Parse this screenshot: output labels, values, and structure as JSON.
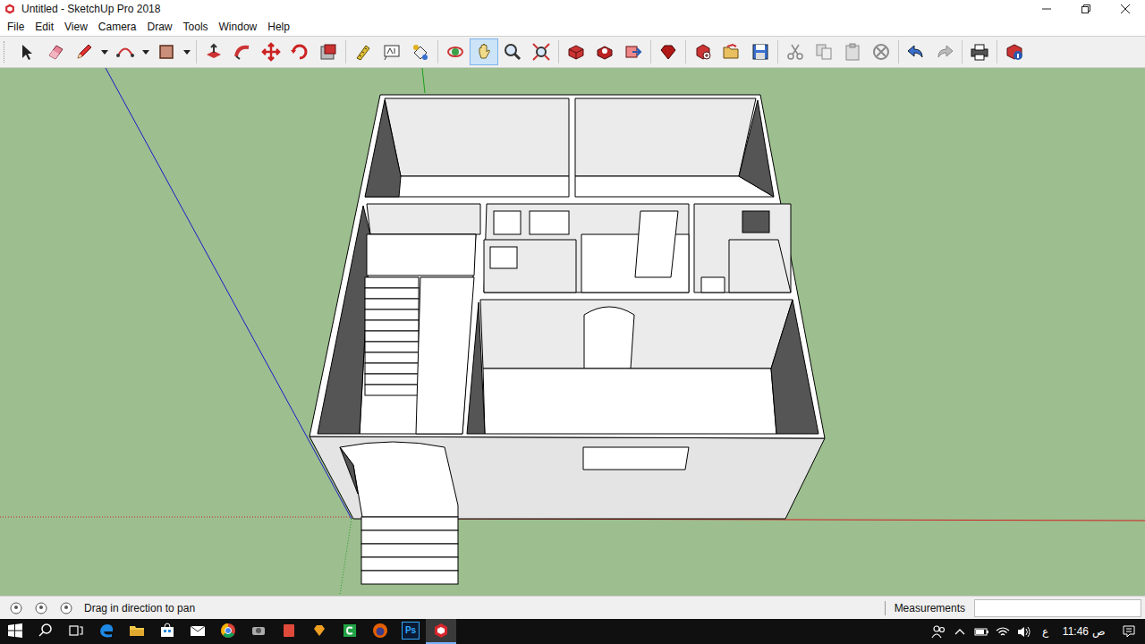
{
  "window": {
    "title": "Untitled - SketchUp Pro 2018"
  },
  "menu": [
    "File",
    "Edit",
    "View",
    "Camera",
    "Draw",
    "Tools",
    "Window",
    "Help"
  ],
  "toolbar": {
    "groups": [
      [
        {
          "kind": "select",
          "selected": false,
          "has_menu": false
        },
        {
          "kind": "eraser",
          "selected": false,
          "has_menu": false
        },
        {
          "kind": "pencil",
          "selected": false,
          "has_menu": true
        },
        {
          "kind": "arc",
          "selected": false,
          "has_menu": true
        },
        {
          "kind": "rectangle",
          "selected": false,
          "has_menu": true
        }
      ],
      [
        {
          "kind": "pushpull",
          "selected": false,
          "has_menu": false
        },
        {
          "kind": "followme",
          "selected": false,
          "has_menu": false
        },
        {
          "kind": "move",
          "selected": false,
          "has_menu": false
        },
        {
          "kind": "rotate",
          "selected": false,
          "has_menu": false
        },
        {
          "kind": "offset",
          "selected": false,
          "has_menu": false
        }
      ],
      [
        {
          "kind": "tape",
          "selected": false,
          "has_menu": false
        },
        {
          "kind": "text",
          "selected": false,
          "has_menu": false
        },
        {
          "kind": "paint",
          "selected": false,
          "has_menu": false
        }
      ],
      [
        {
          "kind": "orbit",
          "selected": false,
          "has_menu": false
        },
        {
          "kind": "pan",
          "selected": true,
          "has_menu": false
        },
        {
          "kind": "zoom",
          "selected": false,
          "has_menu": false
        },
        {
          "kind": "zoomextents",
          "selected": false,
          "has_menu": false
        }
      ],
      [
        {
          "kind": "warehouse",
          "selected": false,
          "has_menu": false
        },
        {
          "kind": "extension",
          "selected": false,
          "has_menu": false
        },
        {
          "kind": "send",
          "selected": false,
          "has_menu": false
        }
      ],
      [
        {
          "kind": "ruby",
          "selected": false,
          "has_menu": false
        }
      ],
      [
        {
          "kind": "new",
          "selected": false,
          "has_menu": false
        },
        {
          "kind": "open",
          "selected": false,
          "has_menu": false
        },
        {
          "kind": "save",
          "selected": false,
          "has_menu": false
        }
      ],
      [
        {
          "kind": "cut",
          "selected": false,
          "has_menu": false
        },
        {
          "kind": "copy",
          "selected": false,
          "has_menu": false
        },
        {
          "kind": "paste",
          "selected": false,
          "has_menu": false
        },
        {
          "kind": "erase",
          "selected": false,
          "has_menu": false
        }
      ],
      [
        {
          "kind": "undo",
          "selected": false,
          "has_menu": false
        },
        {
          "kind": "redo",
          "selected": false,
          "has_menu": false
        }
      ],
      [
        {
          "kind": "print",
          "selected": false,
          "has_menu": false
        }
      ],
      [
        {
          "kind": "info",
          "selected": false,
          "has_menu": false
        }
      ]
    ]
  },
  "status_bar": {
    "hint": "Drag in direction to pan",
    "measurements_label": "Measurements"
  },
  "taskbar": {
    "apps": [
      {
        "kind": "start",
        "active": false
      },
      {
        "kind": "search",
        "active": false
      },
      {
        "kind": "taskview",
        "active": false
      },
      {
        "kind": "edge",
        "active": false
      },
      {
        "kind": "explorer",
        "active": false
      },
      {
        "kind": "store",
        "active": false
      },
      {
        "kind": "mail",
        "active": false
      },
      {
        "kind": "chrome",
        "active": false
      },
      {
        "kind": "gray",
        "active": false
      },
      {
        "kind": "red",
        "active": false
      },
      {
        "kind": "orange",
        "active": false
      },
      {
        "kind": "green",
        "active": false
      },
      {
        "kind": "firefox",
        "active": false
      },
      {
        "kind": "photoshop",
        "active": false,
        "label": "Ps"
      },
      {
        "kind": "sketchup",
        "active": true
      }
    ],
    "tray": [
      "people",
      "chevron",
      "battery",
      "wifi",
      "volume"
    ],
    "input_language": "ع",
    "time": "11:46",
    "period": "ص"
  }
}
